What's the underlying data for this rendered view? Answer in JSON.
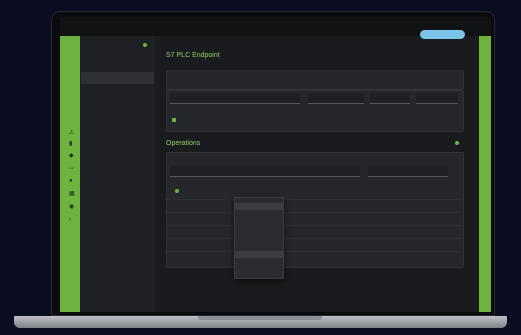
{
  "window": {
    "title": ""
  },
  "header": {
    "brand": "",
    "status": "",
    "action_label": ""
  },
  "sidebar": {
    "title": "",
    "items": [
      {
        "label": ""
      }
    ]
  },
  "endpoint": {
    "title": "S7 PLC Endpoint",
    "field_labels": [
      "",
      "",
      "",
      ""
    ],
    "field_values": [
      "",
      "",
      "",
      ""
    ],
    "checkbox_label": ""
  },
  "operations": {
    "title": "Operations",
    "section_title": "",
    "columns": [
      "",
      "",
      "",
      "",
      ""
    ],
    "rows": [
      "",
      "",
      "",
      "",
      ""
    ]
  },
  "dropdown": {
    "options": [
      "",
      "",
      "",
      "",
      "",
      "",
      ""
    ]
  },
  "footer": {
    "left": "",
    "center": ""
  },
  "colors": {
    "accent": "#6eb33f",
    "pill": "#7cc4e8",
    "panel": "#26272b",
    "bezel": "#0b0b0d"
  }
}
